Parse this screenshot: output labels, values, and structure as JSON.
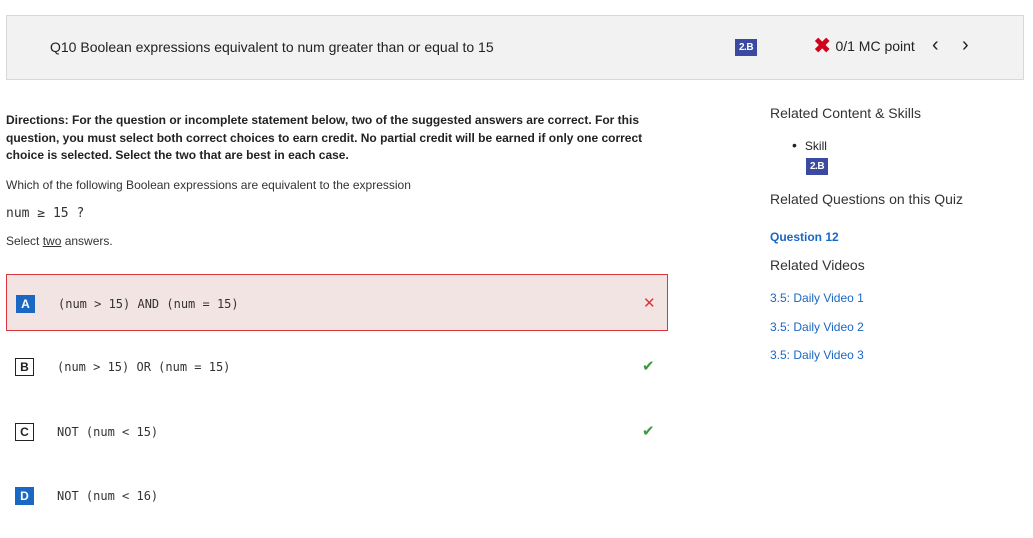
{
  "header": {
    "question_title": "Q10 Boolean expressions equivalent to num greater than or equal to 15",
    "skill_badge": "2.B",
    "score_text": "0/1 MC point",
    "prev_arrow": "‹",
    "next_arrow": "›",
    "wrong_icon": "✖"
  },
  "question": {
    "directions": "Directions: For the question or incomplete statement below, two of the suggested answers are correct. For this question, you must select both correct choices to earn credit. No partial credit will be earned if only one correct choice is selected. Select the two that are best in each case.",
    "prompt": "Which of the following Boolean expressions are equivalent to the expression",
    "expression": "num ≥ 15",
    "expression_suffix": "?",
    "select_prefix": "Select ",
    "select_emphasis": "two",
    "select_suffix": " answers."
  },
  "choices": [
    {
      "letter": "A",
      "code": "(num > 15) AND (num = 15)",
      "selected": true,
      "mark": "✕",
      "mark_type": "wrong"
    },
    {
      "letter": "B",
      "code": "(num > 15) OR (num = 15)",
      "selected": false,
      "mark": "✔",
      "mark_type": "right"
    },
    {
      "letter": "C",
      "code": "NOT (num < 15)",
      "selected": false,
      "mark": "✔",
      "mark_type": "right"
    },
    {
      "letter": "D",
      "code": "NOT (num < 16)",
      "selected": false,
      "mark": "",
      "mark_type": "none"
    }
  ],
  "sidebar": {
    "related_content_heading": "Related Content & Skills",
    "skill_label": "Skill",
    "skill_badge": "2.B",
    "related_questions_heading": "Related Questions on this Quiz",
    "related_question_link": "Question 12",
    "related_videos_heading": "Related Videos",
    "videos": [
      "3.5: Daily Video 1",
      "3.5: Daily Video 2",
      "3.5: Daily Video 3"
    ]
  },
  "colors": {
    "accent_blue": "#1a67c4",
    "badge_blue": "#3b4aa0",
    "error_red": "#d9363e",
    "success_green": "#3c9a3c"
  }
}
